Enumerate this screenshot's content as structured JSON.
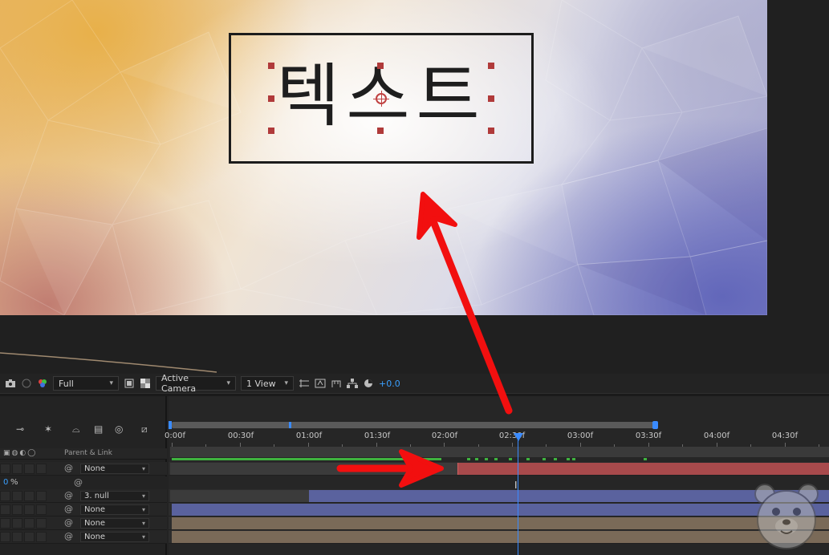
{
  "composition": {
    "text_layer_content": "텍스트"
  },
  "viewer_toolbar": {
    "resolution": "Full",
    "camera": "Active Camera",
    "view_layout": "1 View",
    "exposure_offset": "+0.0"
  },
  "timeline": {
    "column_header_parent": "Parent & Link",
    "time_ruler": [
      "0:00f",
      "00:30f",
      "01:00f",
      "01:30f",
      "02:00f",
      "02:30f",
      "03:00f",
      "03:30f",
      "04:00f",
      "04:30f"
    ],
    "layers": [
      {
        "parent": "None"
      },
      {
        "parent": "3. null"
      },
      {
        "parent": "None"
      },
      {
        "parent": "None"
      },
      {
        "parent": "None"
      }
    ],
    "opacity_value": "0",
    "opacity_suffix": "%"
  },
  "colors": {
    "accent": "#3a8bff",
    "annotation_arrow": "#f20f0f",
    "selected_layer_bar": "#a84a4c",
    "null_layer_bar": "#5a629e"
  }
}
